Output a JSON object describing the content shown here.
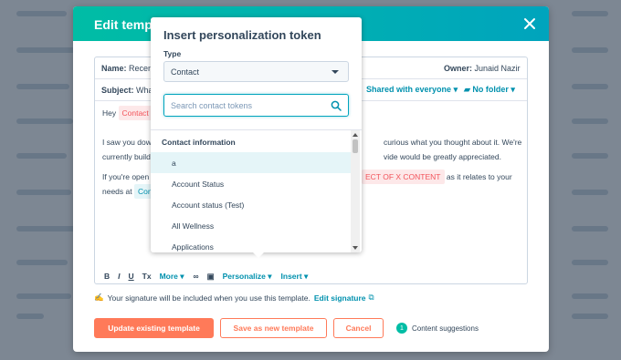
{
  "modal": {
    "title": "Edit template",
    "name_label": "Name:",
    "name_value": "Recent",
    "owner_label": "Owner:",
    "owner_value": "Junaid Nazir",
    "subject_label": "Subject:",
    "subject_value": "What",
    "shared_label": "Shared with everyone",
    "folder_label": "No folder",
    "body": {
      "greeting": "Hey",
      "greeting_token": "Contact",
      "p1_left": "I saw you down",
      "p1_right": "curious what you thought about it. We're",
      "p1b_left": "currently buildi",
      "p1b_right": "vide would be greatly appreciated.",
      "p2_left": "If you're open t",
      "p2_token": "ECT OF X CONTENT",
      "p2_right": "as it relates to your",
      "p2b_left": "needs at",
      "p2b_token": "Con"
    },
    "toolbar": {
      "bold": "B",
      "italic": "I",
      "underline": "U",
      "clear": "Tx",
      "more": "More",
      "personalize": "Personalize",
      "insert": "Insert"
    },
    "signature_text": "Your signature will be included when you use this template.",
    "signature_link": "Edit signature",
    "buttons": {
      "update": "Update existing template",
      "save_new": "Save as new template",
      "cancel": "Cancel"
    },
    "suggestions": {
      "count": "1",
      "label": "Content suggestions"
    }
  },
  "popover": {
    "title": "Insert personalization token",
    "type_label": "Type",
    "type_value": "Contact",
    "search_placeholder": "Search contact tokens",
    "group_header": "Contact information",
    "items": [
      "a",
      "Account Status",
      "Account status (Test)",
      "All Wellness",
      "Applications"
    ]
  },
  "colors": {
    "header_teal": "#00bda5",
    "primary_orange": "#ff7a59",
    "link_teal": "#0091ae",
    "token_red": "#f2545b"
  }
}
